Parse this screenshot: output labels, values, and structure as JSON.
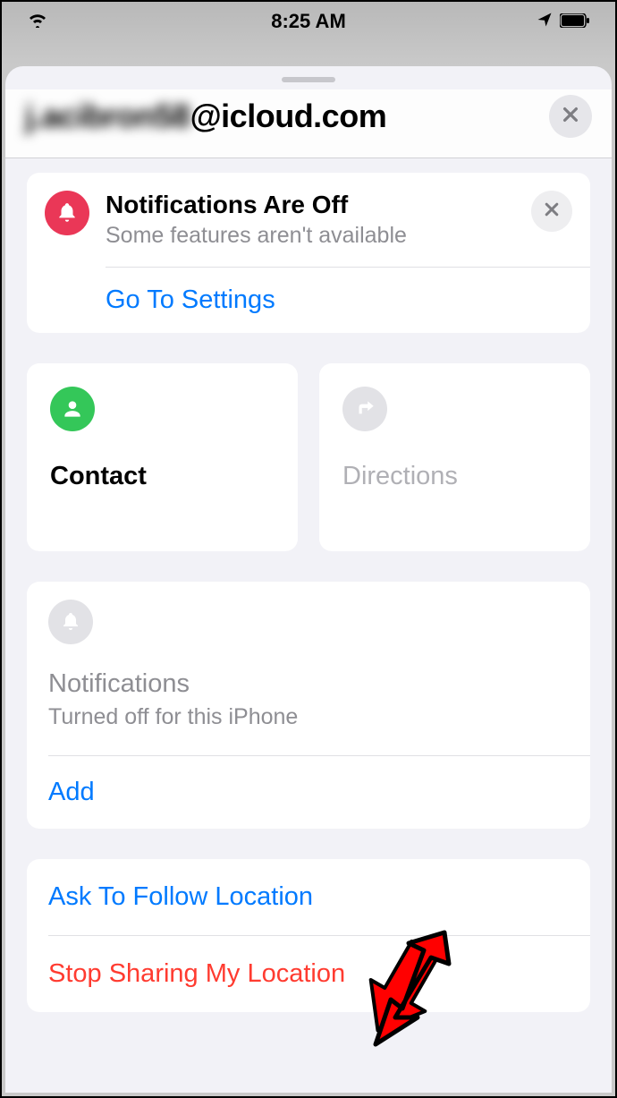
{
  "status": {
    "time": "8:25 AM"
  },
  "header": {
    "title_blurred": "j.acibron58",
    "title_visible": "@icloud.com"
  },
  "notifications_banner": {
    "title": "Notifications Are Off",
    "subtitle": "Some features aren't available",
    "action": "Go To Settings"
  },
  "tiles": {
    "contact": "Contact",
    "directions": "Directions"
  },
  "notifications_section": {
    "title": "Notifications",
    "subtitle": "Turned off for this iPhone",
    "add": "Add"
  },
  "actions": {
    "ask": "Ask To Follow Location",
    "stop": "Stop Sharing My Location"
  }
}
